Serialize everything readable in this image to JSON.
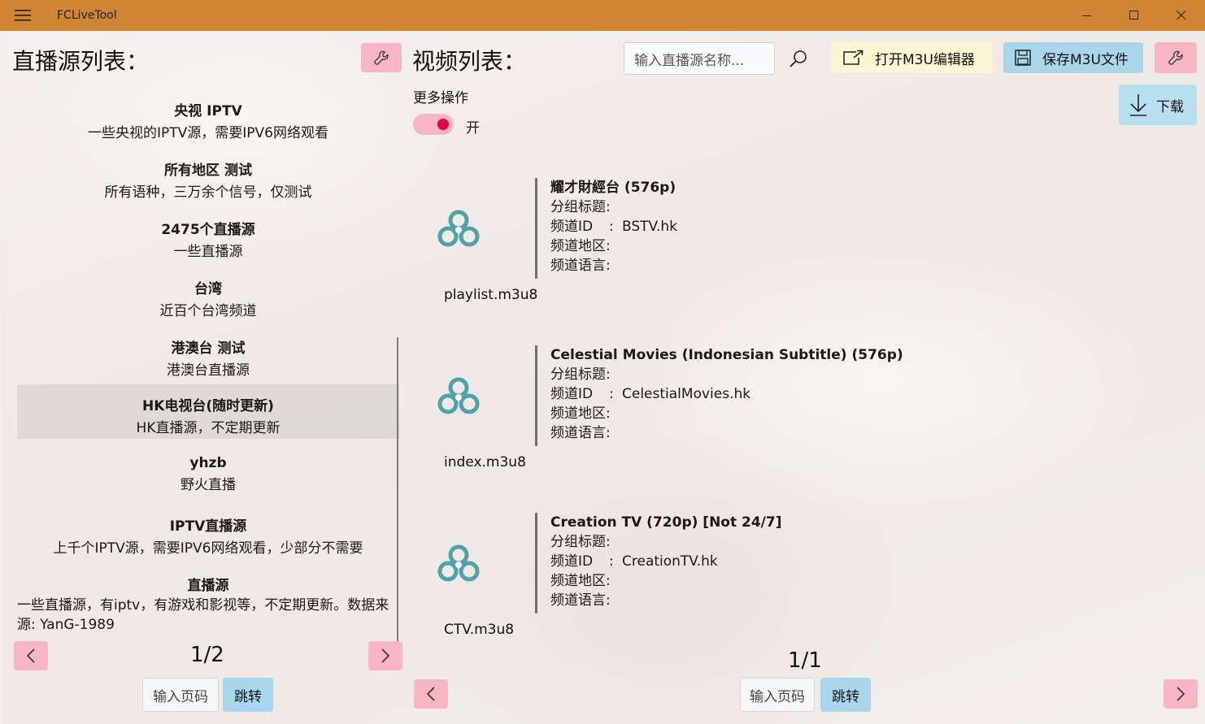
{
  "window": {
    "title": "FCLiveTool"
  },
  "left": {
    "heading": "直播源列表：",
    "sources": [
      {
        "name": "央视 IPTV",
        "desc": "一些央视的IPTV源，需要IPV6网络观看"
      },
      {
        "name": "所有地区 测试",
        "desc": "所有语种，三万余个信号，仅测试"
      },
      {
        "name": "2475个直播源",
        "desc": "一些直播源"
      },
      {
        "name": "台湾",
        "desc": "近百个台湾频道"
      },
      {
        "name": "港澳台 测试",
        "desc": "港澳台直播源"
      },
      {
        "name": "HK电视台(随时更新)",
        "desc": "HK直播源，不定期更新"
      },
      {
        "name": "yhzb",
        "desc": "野火直播"
      },
      {
        "name": "IPTV直播源",
        "desc": "上千个IPTV源，需要IPV6网络观看，少部分不需要"
      },
      {
        "name": "直播源",
        "desc": "一些直播源，有iptv，有游戏和影视等，不定期更新。数据来源: YanG-1989"
      }
    ],
    "page_indicator": "1/2",
    "page_input_placeholder": "输入页码",
    "jump_label": "跳转"
  },
  "right": {
    "heading": "视频列表：",
    "search_placeholder": "输入直播源名称...",
    "open_editor_label": "打开M3U编辑器",
    "save_label": "保存M3U文件",
    "download_label": "下载",
    "more_ops_label": "更多操作",
    "toggle_label": "开",
    "toggle_on": true,
    "field_labels": {
      "group": "分组标题:",
      "id": "频道ID",
      "region": "频道地区:",
      "lang": "频道语言:",
      "sep": ":"
    },
    "videos": [
      {
        "title": "耀才財經台 (576p)",
        "file": "playlist.m3u8",
        "channel_id": "BSTV.hk"
      },
      {
        "title": "Celestial Movies (Indonesian Subtitle) (576p)",
        "file": "index.m3u8",
        "channel_id": "CelestialMovies.hk"
      },
      {
        "title": "Creation TV (720p) [Not 24/7]",
        "file": "CTV.m3u8",
        "channel_id": "CreationTV.hk"
      }
    ],
    "page_indicator": "1/1",
    "page_input_placeholder": "输入页码",
    "jump_label": "跳转"
  },
  "colors": {
    "titlebar": "#cf8532",
    "pink_button": "#f7b6c1",
    "blue_button": "#a9d6ec",
    "yellow_button": "#fbf6d3",
    "toggle_knob": "#e8004d",
    "logo_teal": "#4fa3a8"
  }
}
